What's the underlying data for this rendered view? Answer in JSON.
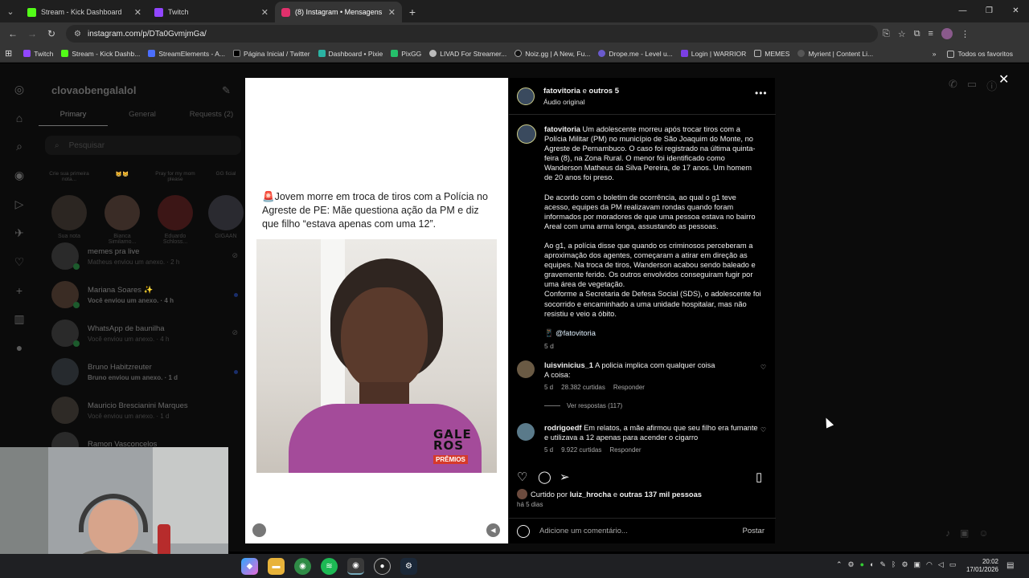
{
  "browser": {
    "tabs": [
      {
        "title": "Stream - Kick Dashboard",
        "color": "#53fc18"
      },
      {
        "title": "Twitch",
        "color": "#9146ff"
      },
      {
        "title": "(8) Instagram • Mensagens",
        "color": "#e1306c"
      }
    ],
    "url": "instagram.com/p/DTa0GvmjmGa/",
    "bookmarks": [
      {
        "label": "Twitch",
        "color": "#9146ff"
      },
      {
        "label": "Stream - Kick Dashb...",
        "color": "#53fc18"
      },
      {
        "label": "StreamElements - A...",
        "color": "#4b6fff"
      },
      {
        "label": "Página Inicial / Twitter",
        "color": "#222222"
      },
      {
        "label": "Dashboard • Pixie",
        "color": "#2bb3a3"
      },
      {
        "label": "PixGG",
        "color": "#25c06b"
      },
      {
        "label": "LIVAD For Streamer...",
        "color": "#bbbbbb"
      },
      {
        "label": "Noiz.gg | A New, Fu...",
        "color": "#111111"
      },
      {
        "label": "Drope.me - Level u...",
        "color": "#6a5acd"
      },
      {
        "label": "Login | WARRIOR",
        "color": "#7b3fe4"
      },
      {
        "label": "MEMES",
        "color": "#999999"
      },
      {
        "label": "Myrient | Content Li...",
        "color": "#555555"
      }
    ],
    "all_bookmarks": "Todos os favoritos"
  },
  "dm": {
    "username": "clovaobengalalol",
    "tabs": [
      "Primary",
      "General",
      "Requests (2)"
    ],
    "search_placeholder": "Pesquisar",
    "notes": [
      {
        "bubble": "Crie sua primeira nota...",
        "name": "Sua nota"
      },
      {
        "bubble": "",
        "name": "Bianca Similamo..."
      },
      {
        "bubble": "Pray for my mom please",
        "name": "Eduardo Schloss..."
      },
      {
        "bubble": "GG ficial",
        "name": "GIGAAN"
      }
    ],
    "conversations": [
      {
        "name": "memes pra live",
        "sub": "Matheus enviou um anexo. · 2 h",
        "bold": false
      },
      {
        "name": "Mariana Soares ✨",
        "sub": "Você enviou um anexo. · 4 h",
        "bold": true
      },
      {
        "name": "WhatsApp de baunilha",
        "sub": "Você enviou um anexo. · 4 h",
        "bold": false
      },
      {
        "name": "Bruno Habitzreuter",
        "sub": "Bruno enviou um anexo. · 1 d",
        "bold": true
      },
      {
        "name": "Mauricio Brescianini Marques",
        "sub": "Você enviou um anexo. · 1 d",
        "bold": false
      },
      {
        "name": "Ramon Vasconcelos",
        "sub": "",
        "bold": false
      }
    ]
  },
  "post": {
    "media_caption": "🚨Jovem morre em troca de tiros com a Polícia no Agreste de PE: Mãe questiona ação da PM e diz que filho “estava apenas com uma 12”.",
    "logo_top": "GALE ROS",
    "logo_bottom": "PRÊMIOS",
    "header_user": "fatovitoria",
    "header_join": "e",
    "header_others": "outros 5",
    "audio": "Áudio original",
    "caption_user": "fatovitoria",
    "caption_p1": "Um adolescente morreu após trocar tiros com a Polícia Militar (PM) no município de São Joaquim do Monte, no Agreste de Pernambuco. O caso foi registrado na última quinta-feira (8), na Zona Rural. O menor foi identificado como Wanderson Matheus da Silva Pereira, de 17 anos. Um homem de 20 anos foi preso.",
    "caption_p2": "De acordo com o boletim de ocorrência, ao qual o g1 teve acesso, equipes da PM realizavam rondas quando foram informados por moradores de que uma pessoa estava no bairro Areal com uma arma longa, assustando as pessoas.",
    "caption_p3": "Ao g1, a polícia disse que quando os criminosos perceberam a aproximação dos agentes, começaram a atirar em direção as equipes. Na troca de tiros, Wanderson acabou sendo baleado e gravemente ferido. Os outros envolvidos conseguiram fugir por uma área de vegetação.",
    "caption_p4": "Conforme a Secretaria de Defesa Social (SDS), o adolescente foi socorrido e encaminhado a uma unidade hospitalar, mas não resistiu e veio a óbito.",
    "caption_mention": "📱 @fatovitoria",
    "caption_age": "5 d",
    "comments": [
      {
        "user": "luisvinicius_1",
        "text": "A policia implica com qualquer coisa",
        "text2": "A coisa:",
        "age": "5 d",
        "likes": "28.382 curtidas",
        "reply": "Responder",
        "replies": "Ver respostas (117)"
      },
      {
        "user": "rodrigoedf",
        "text": "Em relatos, a mãe afirmou que seu filho era fumante e utilizava a 12 apenas para acender o cigarro",
        "age": "5 d",
        "likes": "9.922 curtidas",
        "reply": "Responder"
      }
    ],
    "liked_prefix": "Curtido por",
    "liked_user": "luiz_hrocha",
    "liked_join": "e",
    "liked_others": "outras 137 mil pessoas",
    "when": "há 5 dias",
    "comment_placeholder": "Adicione um comentário...",
    "post_button": "Postar"
  },
  "taskbar": {
    "time": "20:02",
    "date": "17/01/2026"
  }
}
